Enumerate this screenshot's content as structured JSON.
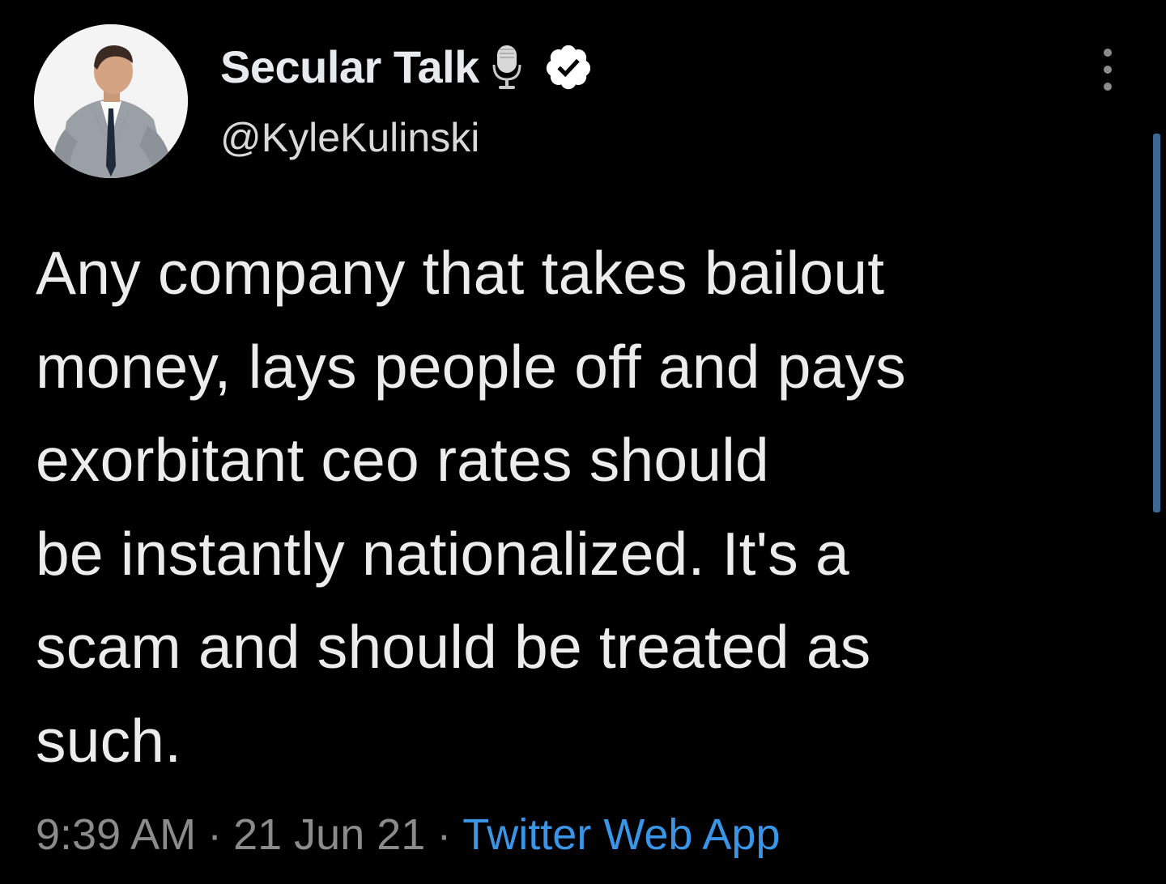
{
  "tweet": {
    "author": {
      "display_name": "Secular Talk",
      "handle": "@KyleKulinski",
      "avatar_icon": "avatar-photo",
      "name_emoji_icon": "microphone-icon",
      "verified_icon": "verified-badge-icon"
    },
    "text_lines": [
      "Any company that takes bailout",
      "money, lays people off and pays",
      "exorbitant ceo rates should",
      "be instantly nationalized. It's a",
      "scam and should be treated as",
      "such."
    ],
    "time": "9:39 AM",
    "separator": "·",
    "date": "21 Jun 21",
    "source": "Twitter Web App",
    "more_icon": "more-vertical-icon"
  },
  "colors": {
    "background": "#000000",
    "text": "#e7e9ea",
    "secondary_text": "#8b8b8b",
    "link": "#3a95e6",
    "verified_badge": "#ffffff",
    "scrollbar": "#3d6a93"
  }
}
